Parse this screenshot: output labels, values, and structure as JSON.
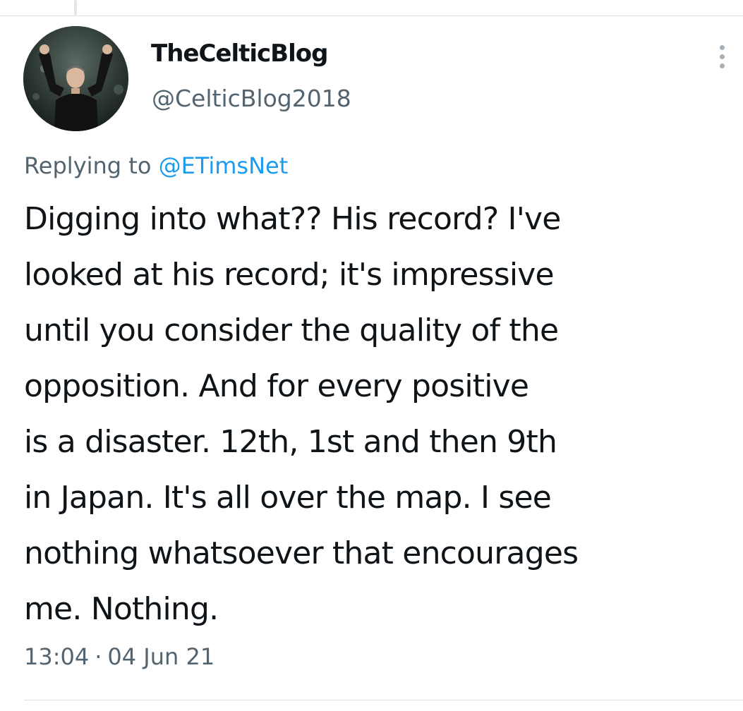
{
  "tweet": {
    "author": {
      "display_name": "TheCelticBlog",
      "handle": "@CelticBlog2018",
      "avatar_icon": "avatar-photo"
    },
    "reply": {
      "prefix": "Replying to ",
      "mention": "@ETimsNet"
    },
    "lines": [
      "Digging into what?? His record? I've",
      "looked at his record; it's impressive",
      "until you consider the quality of the",
      "opposition. And for every positive",
      "is a disaster. 12th, 1st and then 9th",
      "in Japan. It's all over the map. I see",
      "nothing whatsoever that encourages",
      "me. Nothing."
    ],
    "time": "13:04",
    "separator": "·",
    "date": "04 Jun 21",
    "more_icon": "more-vertical-icon"
  },
  "colors": {
    "text": "#0f1419",
    "secondary": "#536471",
    "link": "#1d9bf0",
    "divider": "#dfe3e6"
  }
}
